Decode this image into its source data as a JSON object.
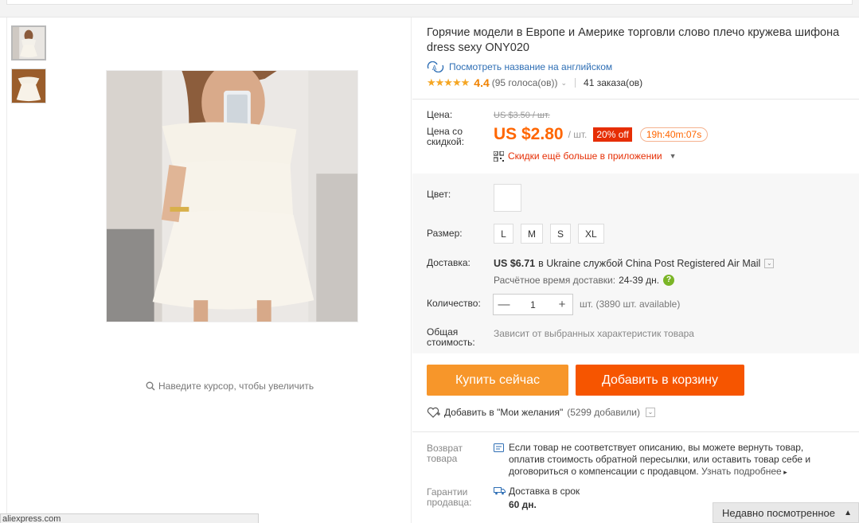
{
  "product": {
    "title": "Горячие модели в Европе и Америке торговли слово плечо кружева шифона dress sexy ONY020",
    "translate_link": "Посмотреть название на английском",
    "rating": {
      "stars": "★★★★★",
      "score": "4.4",
      "votes": "(95 голоса(ов))",
      "orders": "41 заказа(ов)"
    }
  },
  "gallery": {
    "zoom_hint": "Наведите курсор, чтобы увеличить"
  },
  "pricing": {
    "price_label": "Цена:",
    "old_price": "US $3.50 / шт.",
    "discount_label": "Цена со скидкой:",
    "price": "US $2.80",
    "unit": "/ шт.",
    "discount_badge": "20% off",
    "timer": "19h:40m:07s",
    "app_deal": "Скидки ещё больше в приложении"
  },
  "options": {
    "color_label": "Цвет:",
    "size_label": "Размер:",
    "sizes": [
      "L",
      "M",
      "S",
      "XL"
    ],
    "shipping_label": "Доставка:",
    "shipping_price": "US $6.71",
    "shipping_text": "в Ukraine службой China Post Registered Air Mail",
    "delivery_time_label": "Расчётное время доставки:",
    "delivery_days": "24-39 дн.",
    "quantity_label": "Количество:",
    "quantity": "1",
    "qty_minus": "—",
    "qty_plus": "+",
    "stock": "шт. (3890 шт. available)",
    "total_label": "Общая стоимость:",
    "total_value": "Зависит от выбранных характеристик товара"
  },
  "actions": {
    "buy_now": "Купить сейчас",
    "add_to_cart": "Добавить в корзину",
    "wishlist": "Добавить в \"Мои желания\"",
    "wishlist_count": "(5299 добавили)"
  },
  "guarantees": {
    "return_label": "Возврат товара",
    "return_text": "Если товар не соответствует описанию, вы можете вернуть товар, оплатив стоимость обратной пересылки, или оставить товар себе и договориться о компенсации с продавцом.",
    "return_more": "Узнать подробнее",
    "seller_label": "Гарантии продавца:",
    "seller_text": "Доставка в срок",
    "seller_days": "60 дн."
  },
  "recently_viewed": "Недавно посмотренное",
  "statusbar": "aliexpress.com",
  "colors": {
    "price_orange": "#ff6600",
    "buy_button": "#f7962a",
    "cart_button": "#f65500",
    "discount_red": "#e62e04",
    "link_blue": "#2f6fb5",
    "star": "#f5a623"
  }
}
